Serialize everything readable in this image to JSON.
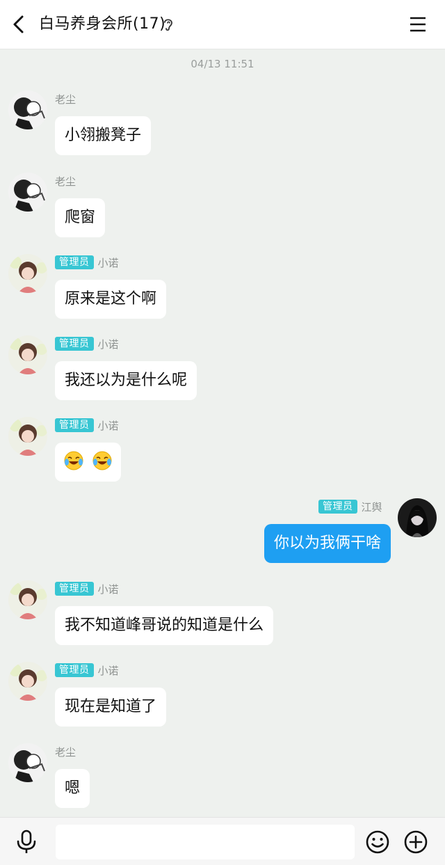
{
  "header": {
    "title": "白马养身会所(17)"
  },
  "timestamp": "04/13 11:51",
  "messages": [
    {
      "sender": "老尘",
      "admin": false,
      "text": "小翎搬凳子"
    },
    {
      "sender": "老尘",
      "admin": false,
      "text": "爬窗"
    },
    {
      "sender": "小诺",
      "admin": true,
      "badge": "管理员",
      "text": "原来是这个啊"
    },
    {
      "sender": "小诺",
      "admin": true,
      "badge": "管理员",
      "text": "我还以为是什么呢"
    },
    {
      "sender": "小诺",
      "admin": true,
      "badge": "管理员",
      "text": "",
      "emoji": [
        "laughing-tears-emoji",
        "laughing-tears-emoji"
      ]
    },
    {
      "sender": "江舆",
      "admin": true,
      "badge": "管理员",
      "text": "你以为我俩干啥",
      "mine": true
    },
    {
      "sender": "小诺",
      "admin": true,
      "badge": "管理员",
      "text": "我不知道峰哥说的知道是什么"
    },
    {
      "sender": "小诺",
      "admin": true,
      "badge": "管理员",
      "text": "现在是知道了"
    },
    {
      "sender": "老尘",
      "admin": false,
      "text": "嗯"
    }
  ],
  "colors": {
    "background": "#eef1ee",
    "admin_badge": "#38c6d3",
    "my_bubble": "#1e9ff2"
  },
  "icons": {
    "back": "chevron-left-icon",
    "hearing": "ear-icon",
    "menu": "hamburger-menu-icon",
    "voice": "microphone-icon",
    "emoji": "smiley-icon",
    "more": "plus-circle-icon"
  }
}
